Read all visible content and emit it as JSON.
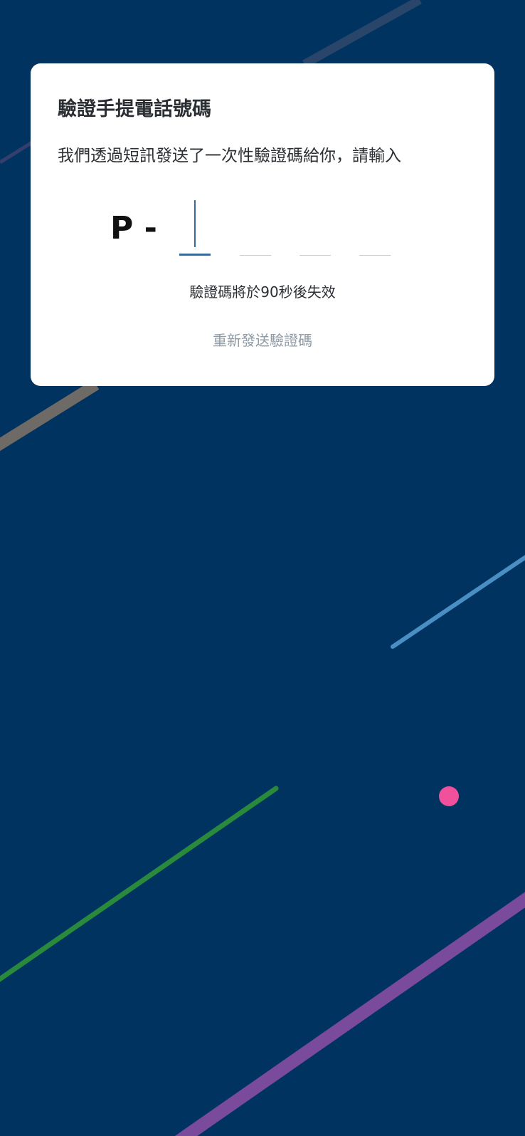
{
  "card": {
    "title": "驗證手提電話號碼",
    "description": "我們透過短訊發送了一次性驗證碼給你，請輸入",
    "otp_prefix": "P -",
    "otp_digits": [
      "",
      "",
      "",
      ""
    ],
    "expiry_text": "驗證碼將於90秒後失效",
    "resend_label": "重新發送驗證碼"
  },
  "colors": {
    "background": "#003360",
    "card": "#ffffff",
    "active_input": "#3a6a9a",
    "resend_text": "#8f9ba6",
    "line_gray": "#6e6a66",
    "line_blue": "#4a8fc4",
    "line_green": "#2a8a3c",
    "line_purple": "#7a4a9c",
    "dot_pink": "#f0509c"
  }
}
